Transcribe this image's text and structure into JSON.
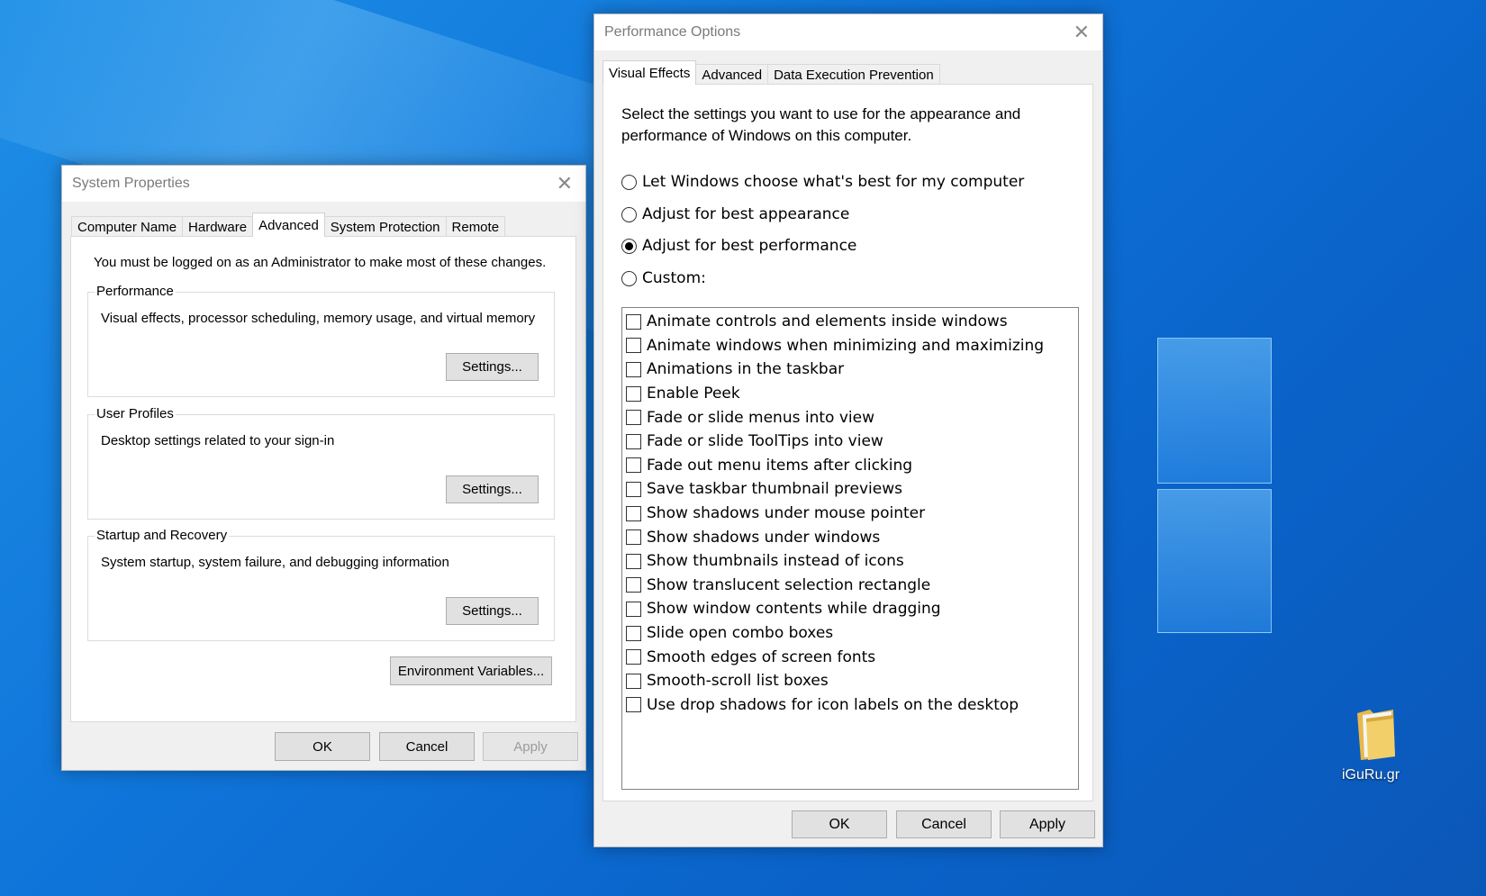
{
  "desktop": {
    "icon_label": "iGuRu.gr"
  },
  "system_properties": {
    "title": "System Properties",
    "tabs": [
      {
        "label": "Computer Name"
      },
      {
        "label": "Hardware"
      },
      {
        "label": "Advanced",
        "active": true
      },
      {
        "label": "System Protection"
      },
      {
        "label": "Remote"
      }
    ],
    "admin_note": "You must be logged on as an Administrator to make most of these changes.",
    "groups": [
      {
        "label": "Performance",
        "desc": "Visual effects, processor scheduling, memory usage, and virtual memory",
        "button": "Settings..."
      },
      {
        "label": "User Profiles",
        "desc": "Desktop settings related to your sign-in",
        "button": "Settings..."
      },
      {
        "label": "Startup and Recovery",
        "desc": "System startup, system failure, and debugging information",
        "button": "Settings..."
      }
    ],
    "env_button": "Environment Variables...",
    "ok": "OK",
    "cancel": "Cancel",
    "apply": "Apply"
  },
  "performance_options": {
    "title": "Performance Options",
    "tabs": [
      {
        "label": "Visual Effects",
        "active": true
      },
      {
        "label": "Advanced"
      },
      {
        "label": "Data Execution Prevention"
      }
    ],
    "intro": "Select the settings you want to use for the appearance and performance of Windows on this computer.",
    "radios": [
      {
        "label": "Let Windows choose what's best for my computer",
        "checked": false
      },
      {
        "label": "Adjust for best appearance",
        "checked": false
      },
      {
        "label": "Adjust for best performance",
        "checked": true
      },
      {
        "label": "Custom:",
        "checked": false
      }
    ],
    "effects": [
      "Animate controls and elements inside windows",
      "Animate windows when minimizing and maximizing",
      "Animations in the taskbar",
      "Enable Peek",
      "Fade or slide menus into view",
      "Fade or slide ToolTips into view",
      "Fade out menu items after clicking",
      "Save taskbar thumbnail previews",
      "Show shadows under mouse pointer",
      "Show shadows under windows",
      "Show thumbnails instead of icons",
      "Show translucent selection rectangle",
      "Show window contents while dragging",
      "Slide open combo boxes",
      "Smooth edges of screen fonts",
      "Smooth-scroll list boxes",
      "Use drop shadows for icon labels on the desktop"
    ],
    "ok": "OK",
    "cancel": "Cancel",
    "apply": "Apply"
  }
}
